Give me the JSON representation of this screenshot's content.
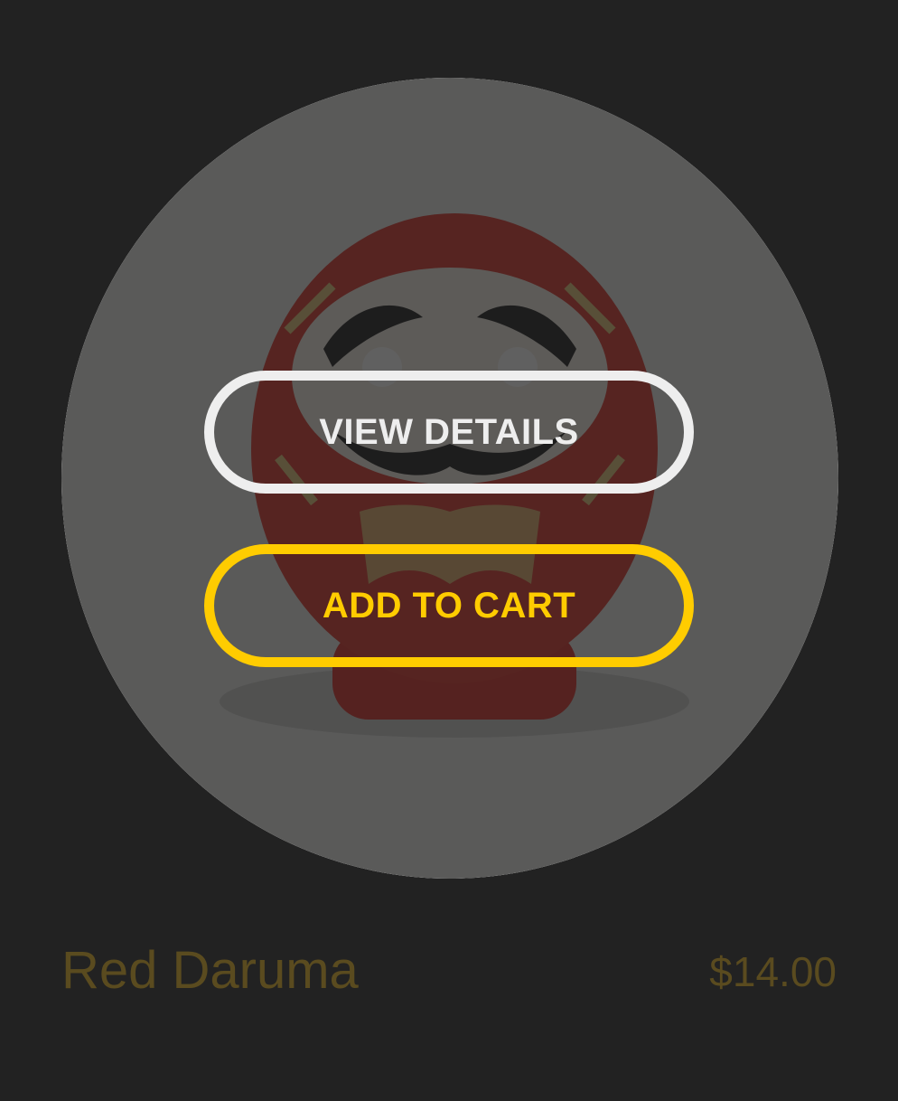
{
  "product": {
    "name": "Red Daruma",
    "price": "$14.00",
    "image_icon": "red-daruma-doll-image"
  },
  "actions": {
    "view_details_label": "VIEW DETAILS",
    "add_to_cart_label": "ADD TO CART"
  },
  "colors": {
    "background": "#222222",
    "accent": "#ffcc00",
    "secondary_button": "#eeeeee",
    "product_text": "#5a4b1f"
  }
}
